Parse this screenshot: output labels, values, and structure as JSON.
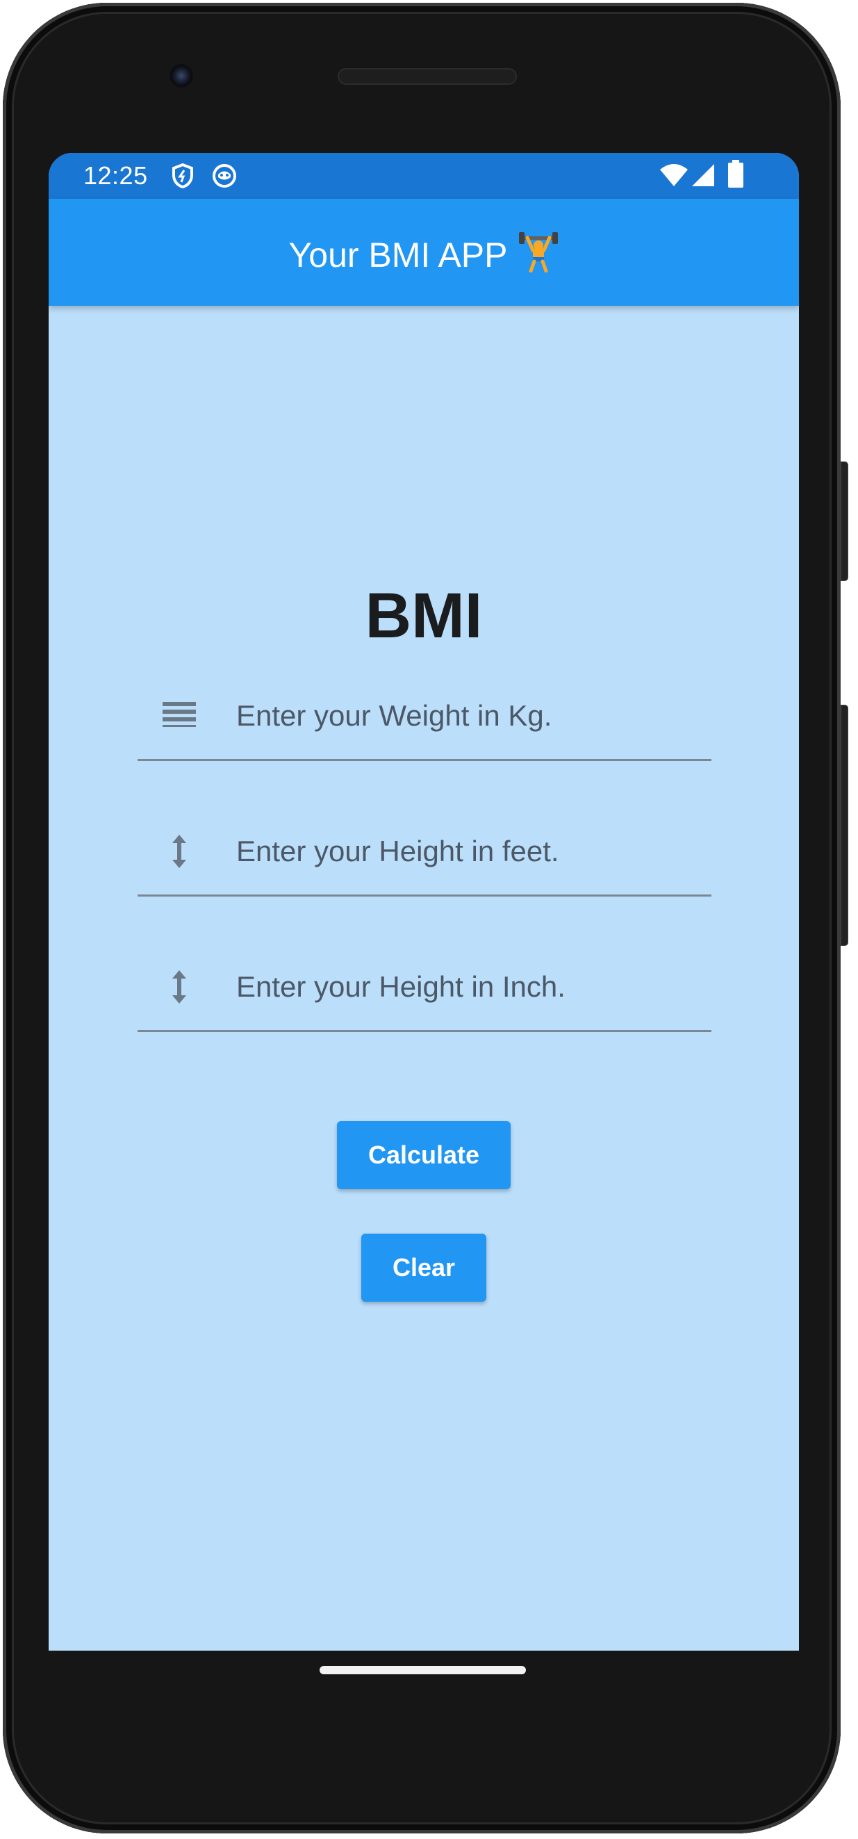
{
  "status_bar": {
    "time": "12:25",
    "left_icons": [
      "shield-icon",
      "app-notification-icon"
    ],
    "right_icons": [
      "wifi-icon",
      "cell-signal-icon",
      "battery-icon"
    ]
  },
  "appbar": {
    "title": "Your BMI APP",
    "title_emoji": "weightlifter-emoji-icon"
  },
  "main": {
    "heading": "BMI",
    "fields": [
      {
        "icon": "weight-lines-icon",
        "placeholder": "Enter your Weight in Kg."
      },
      {
        "icon": "height-arrow-icon",
        "placeholder": "Enter your Height in feet."
      },
      {
        "icon": "height-arrow-icon",
        "placeholder": "Enter your Height in Inch."
      }
    ],
    "buttons": {
      "calculate": "Calculate",
      "clear": "Clear"
    }
  },
  "colors": {
    "status_bar": "#1976d2",
    "appbar": "#2196f3",
    "background": "#bbdefb",
    "button": "#2196f3",
    "heading_text": "#1a1c1e",
    "hint_text": "#4c5866"
  }
}
